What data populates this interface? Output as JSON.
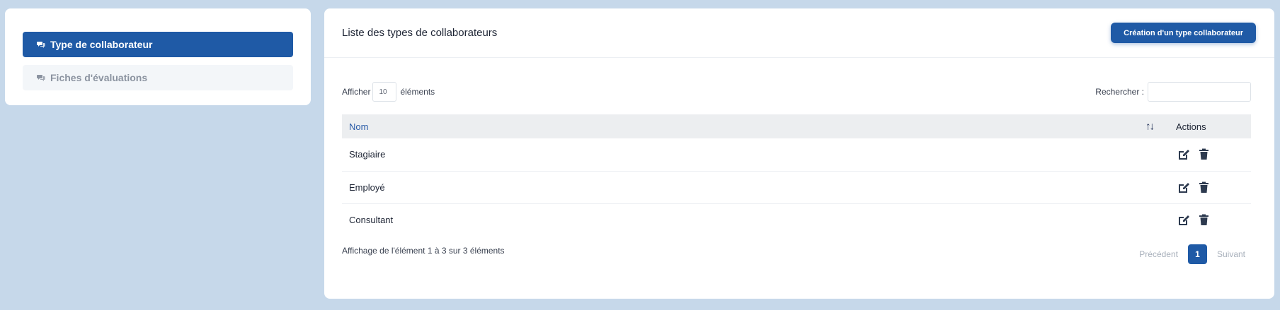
{
  "sidebar": {
    "items": [
      {
        "label": "Type de collaborateur",
        "active": true,
        "icon": "comments-icon"
      },
      {
        "label": "Fiches d'évaluations",
        "active": false,
        "icon": "comments-icon"
      }
    ]
  },
  "main": {
    "title": "Liste des types de collaborateurs",
    "create_button": "Création d'un type collaborateur",
    "length": {
      "prefix": "Afficher",
      "value": "10",
      "suffix": "éléments"
    },
    "search": {
      "label": "Rechercher :",
      "value": ""
    },
    "table": {
      "columns": [
        "Nom",
        "Actions"
      ],
      "rows": [
        {
          "name": "Stagiaire"
        },
        {
          "name": "Employé"
        },
        {
          "name": "Consultant"
        }
      ]
    },
    "info": "Affichage de l'élément 1 à 3 sur 3 éléments",
    "pagination": {
      "previous": "Précédent",
      "current": "1",
      "next": "Suivant"
    }
  },
  "colors": {
    "background": "#c6d8ea",
    "accent": "#1f5aa6",
    "header_row": "#eceef0"
  }
}
